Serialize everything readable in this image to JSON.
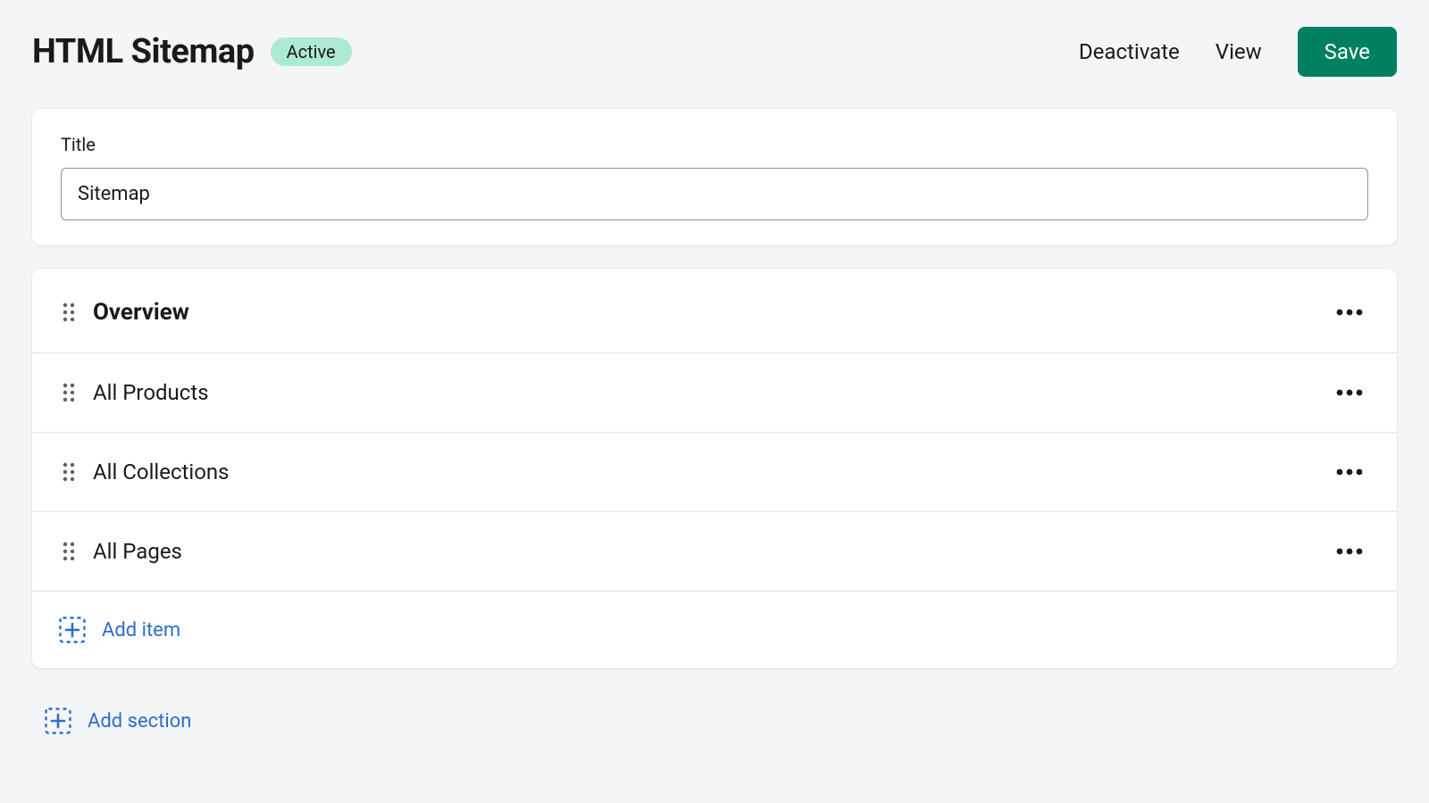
{
  "header": {
    "title": "HTML Sitemap",
    "badge": "Active",
    "deactivate": "Deactivate",
    "view": "View",
    "save": "Save"
  },
  "title_field": {
    "label": "Title",
    "value": "Sitemap"
  },
  "sections": {
    "overview": "Overview",
    "items": [
      "All Products",
      "All Collections",
      "All Pages"
    ],
    "add_item": "Add item"
  },
  "add_section": "Add section"
}
